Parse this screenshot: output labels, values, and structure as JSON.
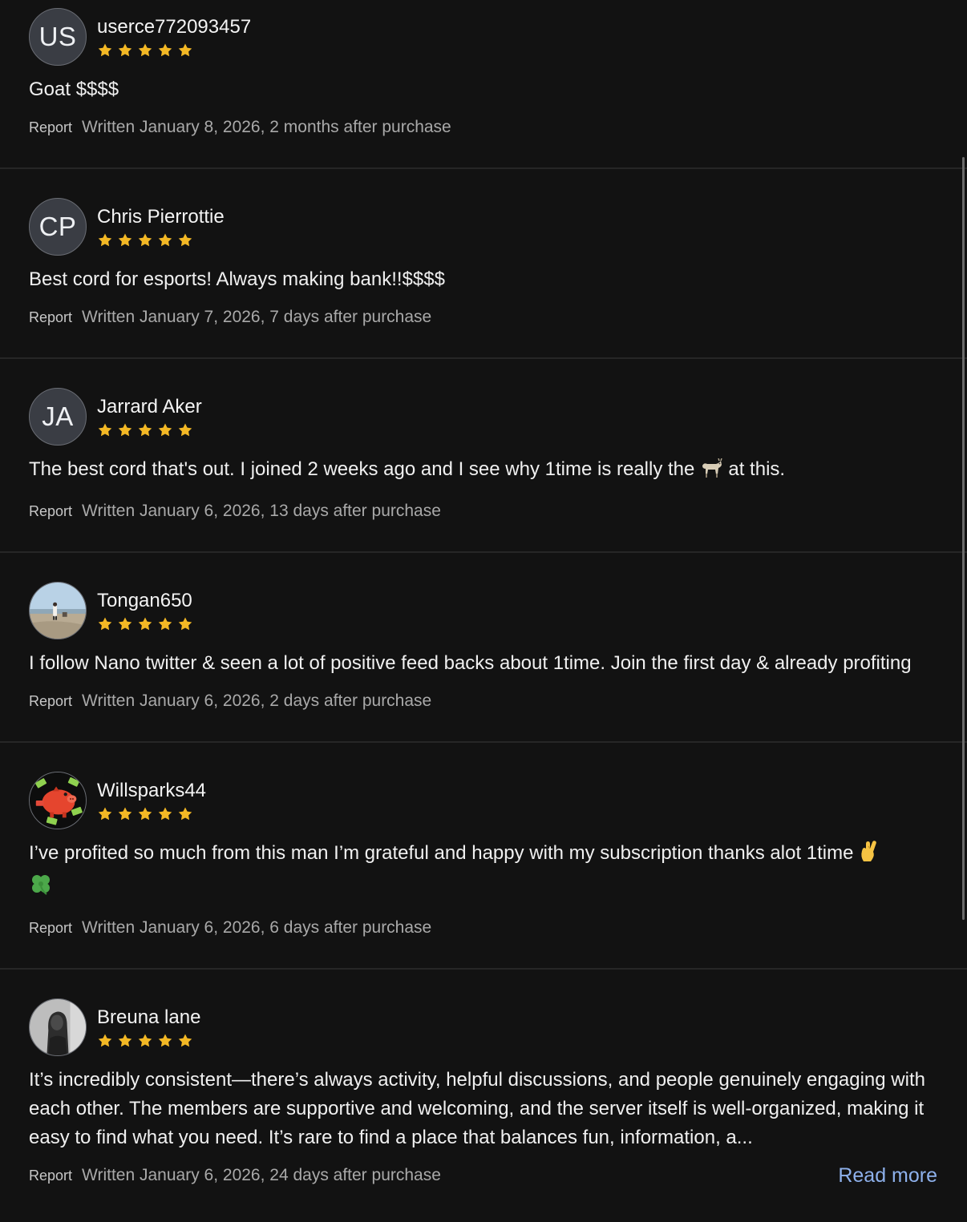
{
  "colors": {
    "background": "#121212",
    "star": "#f3b825",
    "link": "#8eb1ec",
    "divider": "#262626"
  },
  "reviews": [
    {
      "username": "userce772093457",
      "avatar": {
        "type": "initials",
        "initials": "US"
      },
      "rating": 5,
      "text": "Goat $$$$",
      "report_label": "Report",
      "written": "Written January 8, 2026, 2 months after purchase"
    },
    {
      "username": "Chris Pierrottie",
      "avatar": {
        "type": "initials",
        "initials": "CP"
      },
      "rating": 5,
      "text": "Best cord for esports! Always making bank!!$$$$",
      "report_label": "Report",
      "written": "Written January 7, 2026, 7 days after purchase"
    },
    {
      "username": "Jarrard Aker",
      "avatar": {
        "type": "initials",
        "initials": "JA"
      },
      "rating": 5,
      "text_before": "The best cord that's out. I joined 2 weeks ago and I see why 1time is really the",
      "emoji": "goat-emoji",
      "text_after": "at this.",
      "report_label": "Report",
      "written": "Written January 6, 2026, 13 days after purchase"
    },
    {
      "username": "Tongan650",
      "avatar": {
        "type": "photo",
        "icon": "beach-photo-avatar"
      },
      "rating": 5,
      "text": "I follow Nano twitter & seen a lot of positive feed backs about 1time. Join the first day & already profiting",
      "report_label": "Report",
      "written": "Written January 6, 2026, 2 days after purchase"
    },
    {
      "username": "Willsparks44",
      "avatar": {
        "type": "photo",
        "icon": "piggy-bank-avatar"
      },
      "rating": 5,
      "text": "I’ve profited so much from this man I’m grateful and happy with my subscription thanks alot 1time",
      "emojis": [
        "crossed-fingers-emoji",
        "four-leaf-clover-emoji"
      ],
      "report_label": "Report",
      "written": "Written January 6, 2026, 6 days after purchase"
    },
    {
      "username": "Breuna lane",
      "avatar": {
        "type": "photo",
        "icon": "portrait-photo-avatar"
      },
      "rating": 5,
      "text": "It’s incredibly consistent—there’s always activity, helpful discussions, and people genuinely engaging with each other. The members are supportive and welcoming, and the server itself is well-organized, making it easy to find what you need. It’s rare to find a place that balances fun, information, a...",
      "report_label": "Report",
      "written": "Written January 6, 2026, 24 days after purchase",
      "read_more_label": "Read more"
    }
  ]
}
